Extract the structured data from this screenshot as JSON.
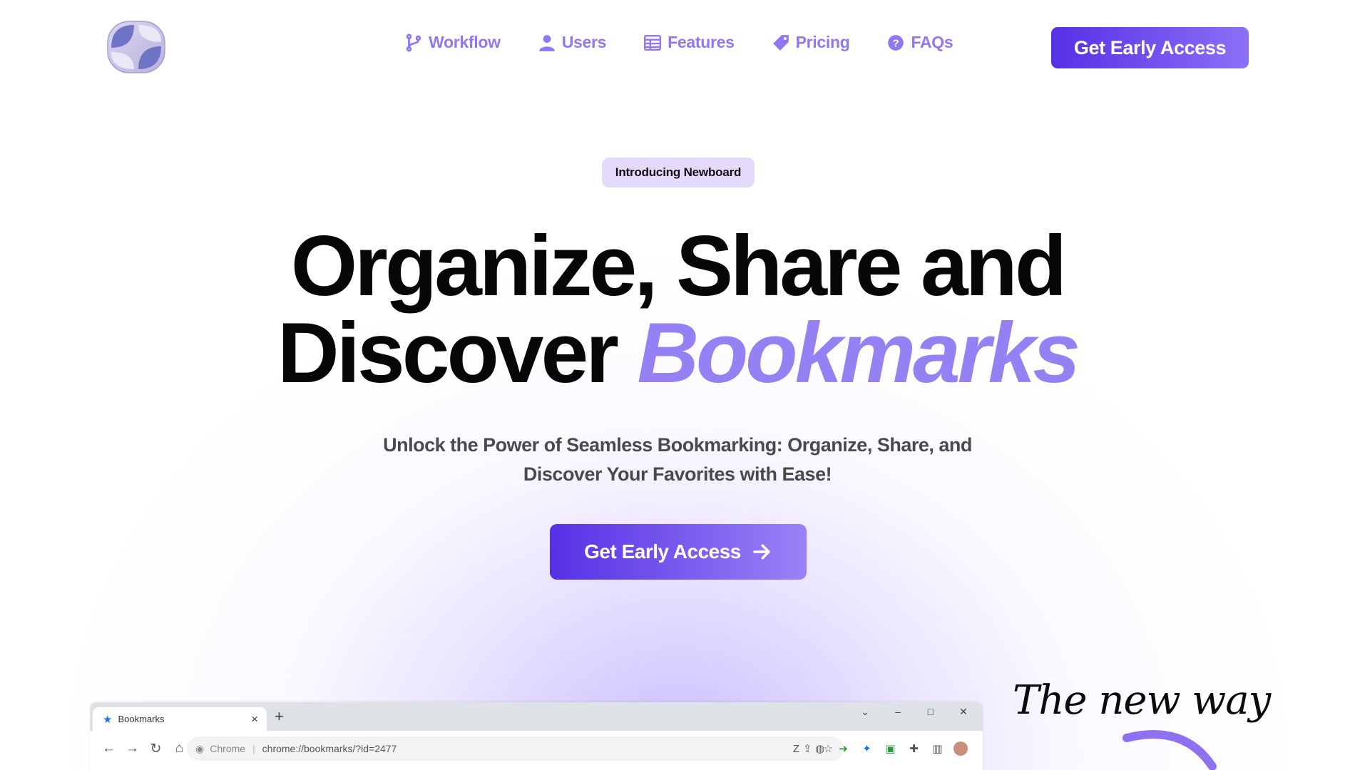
{
  "nav": {
    "links": [
      {
        "label": "Workflow",
        "icon": "git-branch-icon"
      },
      {
        "label": "Users",
        "icon": "user-icon"
      },
      {
        "label": "Features",
        "icon": "table-icon"
      },
      {
        "label": "Pricing",
        "icon": "tag-icon"
      },
      {
        "label": "FAQs",
        "icon": "question-circle-icon"
      }
    ],
    "cta_label": "Get Early Access"
  },
  "hero": {
    "badge": "Introducing Newboard",
    "headline_line1": "Organize, Share and",
    "headline_line2": "Discover",
    "headline_accent": "Bookmarks",
    "subtitle_line1": "Unlock the Power of Seamless Bookmarking: Organize, Share, and",
    "subtitle_line2": "Discover Your Favorites with Ease!",
    "cta_label": "Get Early Access"
  },
  "browser": {
    "tab_title": "Bookmarks",
    "omnibox_label": "Chrome",
    "omnibox_url": "chrome://bookmarks/?id=2477"
  },
  "tagline": "The new way",
  "colors": {
    "accent": "#9277f2",
    "cta_start": "#5530e6",
    "cta_end": "#8c70f6",
    "badge_bg": "#e4dafc",
    "headline_accent": "#9580f4"
  }
}
